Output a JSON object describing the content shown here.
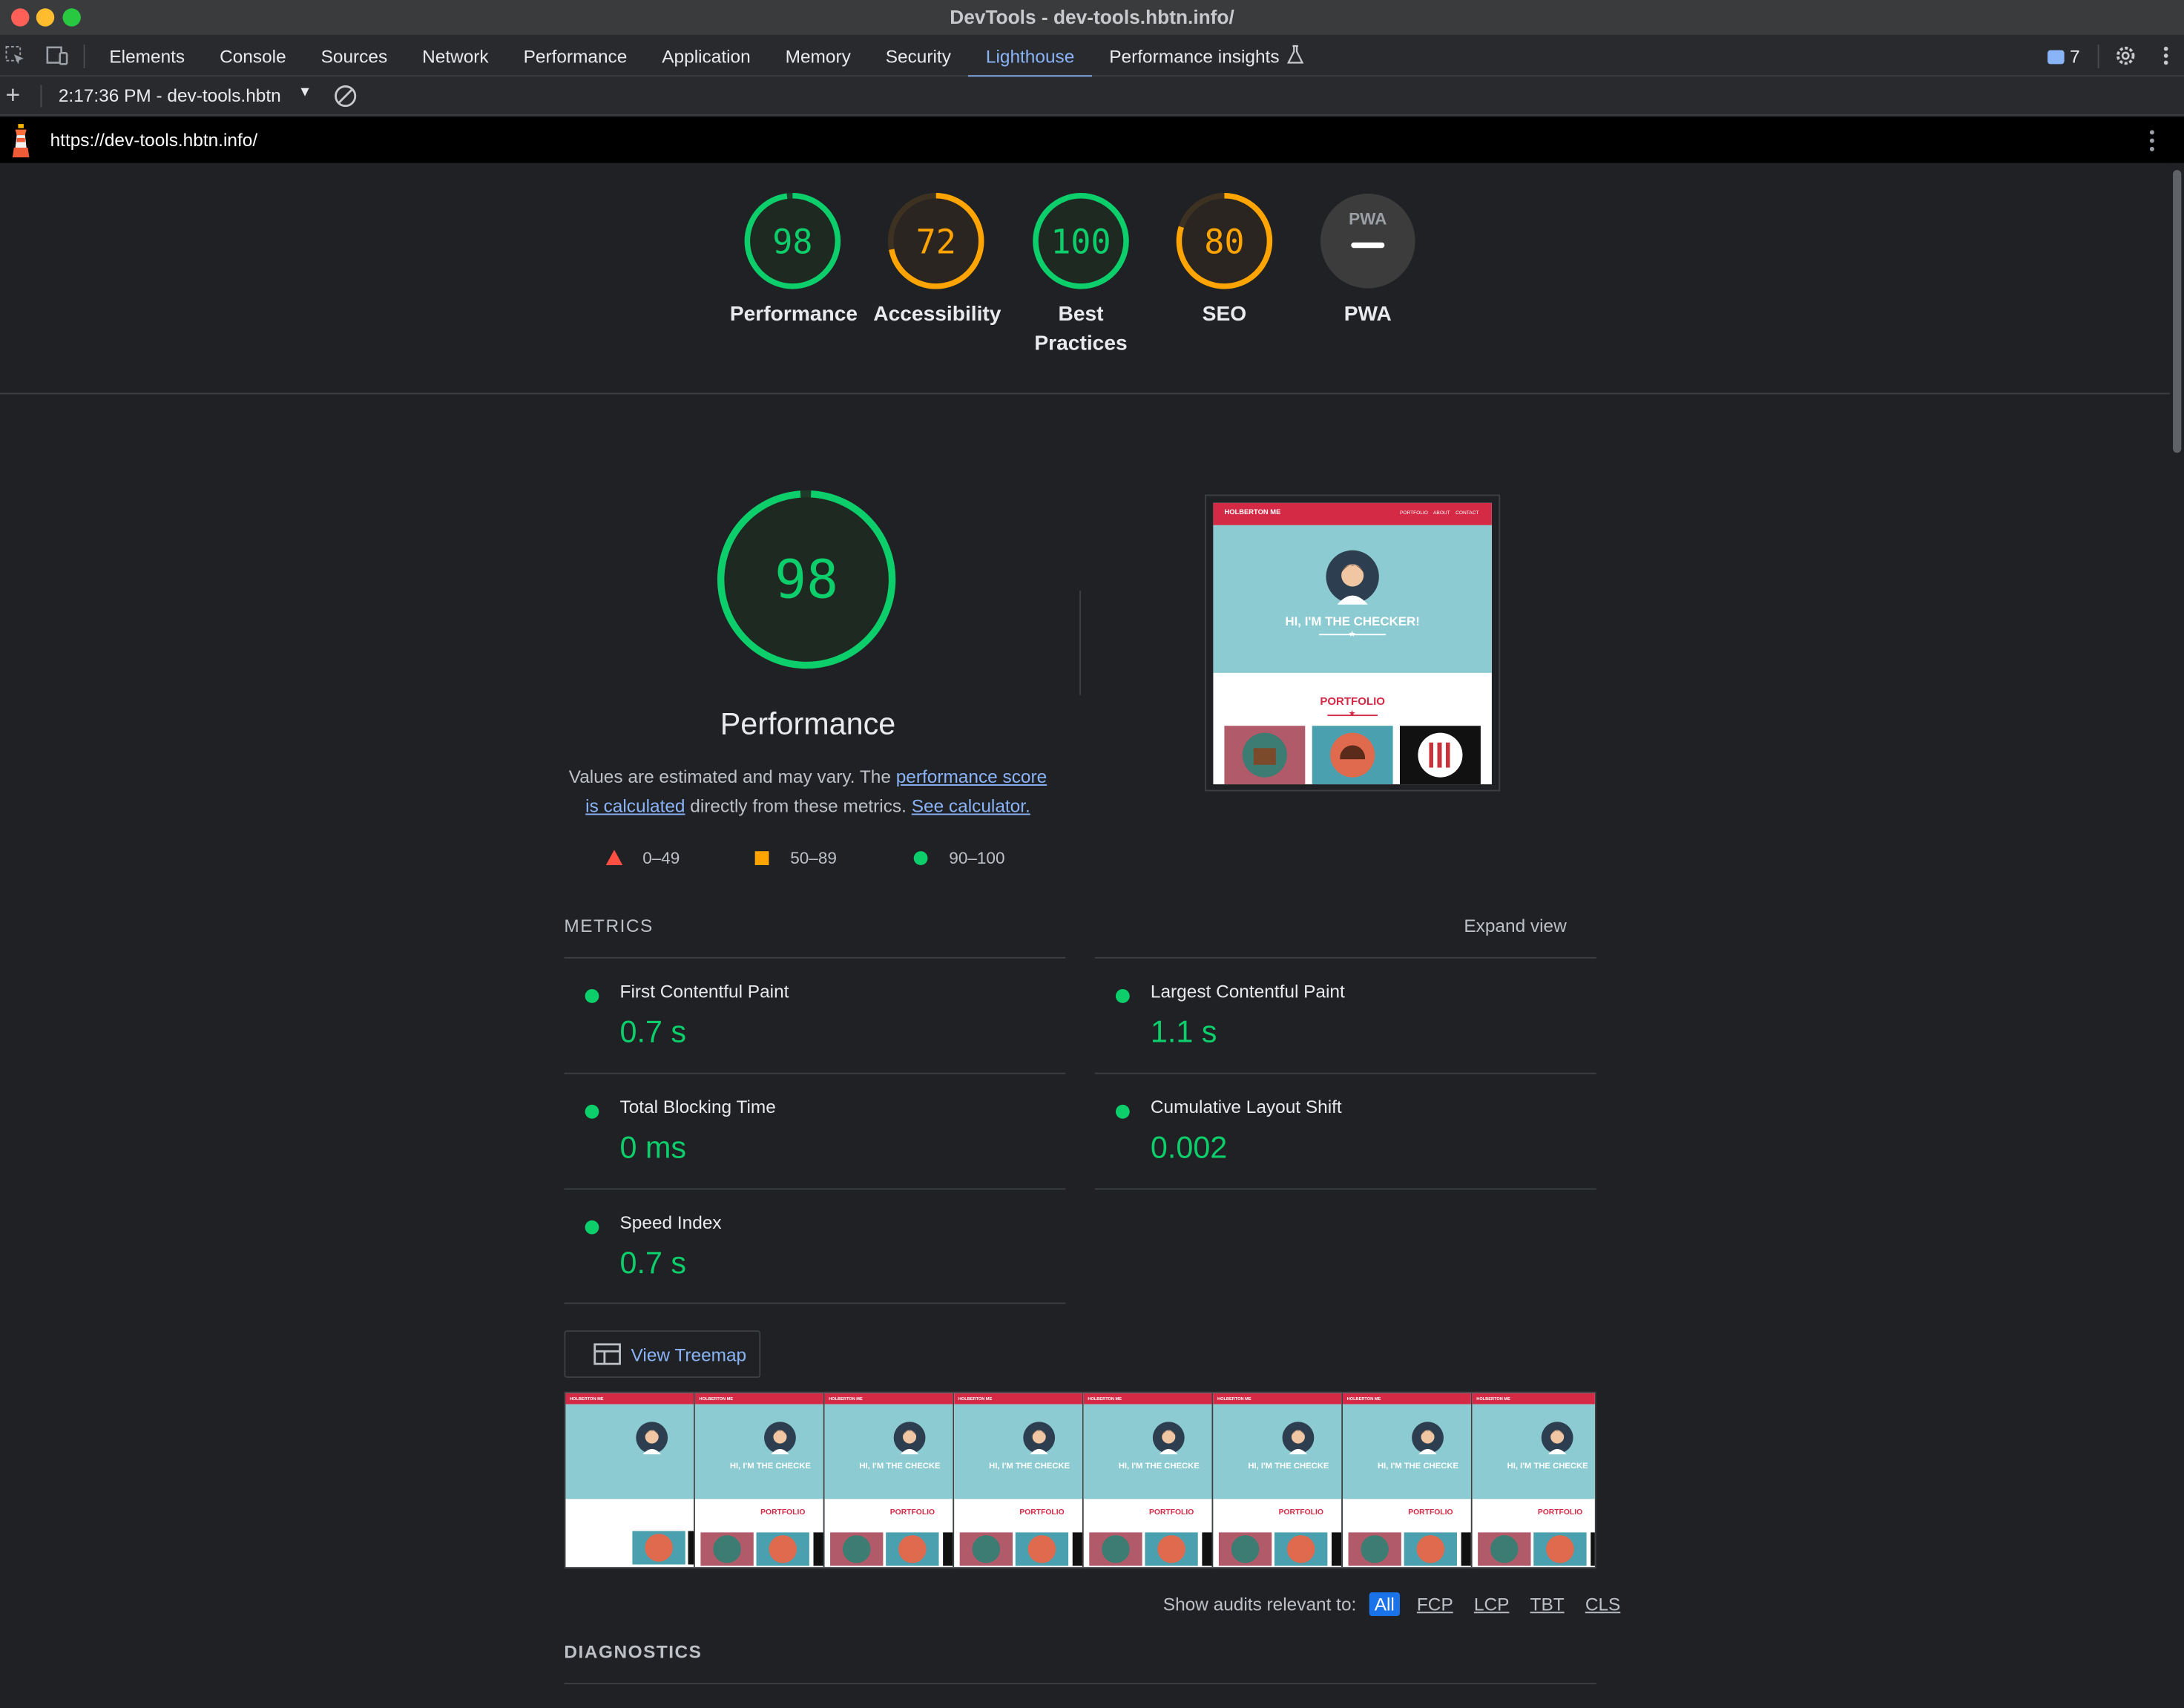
{
  "window": {
    "title": "DevTools - dev-tools.hbtn.info/"
  },
  "toolbar": {
    "tabs": [
      "Elements",
      "Console",
      "Sources",
      "Network",
      "Performance",
      "Application",
      "Memory",
      "Security",
      "Lighthouse",
      "Performance insights"
    ],
    "active_tab": "Lighthouse",
    "issues_count": "7"
  },
  "report_bar": {
    "report_select": "2:17:36 PM - dev-tools.hbtn"
  },
  "url_bar": {
    "url": "https://dev-tools.hbtn.info/"
  },
  "gauges": [
    {
      "score": "98",
      "label": "Performance",
      "fraction": 0.98,
      "color": "#0cce6b"
    },
    {
      "score": "72",
      "label": "Accessibility",
      "fraction": 0.72,
      "color": "#ffa400"
    },
    {
      "score": "100",
      "label": "Best Practices",
      "fraction": 1.0,
      "color": "#0cce6b"
    },
    {
      "score": "80",
      "label": "SEO",
      "fraction": 0.8,
      "color": "#ffa400"
    },
    {
      "score": "",
      "label": "PWA",
      "badge": "PWA"
    }
  ],
  "performance": {
    "score": "98",
    "fraction": 0.98,
    "title": "Performance",
    "desc_1": "Values are estimated and may vary. The ",
    "link_1": "performance score is calculated",
    "desc_2": " directly from these metrics. ",
    "link_2": "See calculator.",
    "legend": [
      "0–49",
      "50–89",
      "90–100"
    ]
  },
  "screenshot": {
    "brand": "HOLBERTON ME",
    "nav": [
      "PORTFOLIO",
      "ABOUT",
      "CONTACT"
    ],
    "hero": "HI, I'M THE CHECKER!",
    "section": "PORTFOLIO",
    "frame_hero": "HI, I'M THE CHECKE",
    "frame_section": "PORTFOLIO"
  },
  "metrics": {
    "heading": "METRICS",
    "expand": "Expand view",
    "items": [
      {
        "name": "First Contentful Paint",
        "value": "0.7 s"
      },
      {
        "name": "Largest Contentful Paint",
        "value": "1.1 s"
      },
      {
        "name": "Total Blocking Time",
        "value": "0 ms"
      },
      {
        "name": "Cumulative Layout Shift",
        "value": "0.002"
      },
      {
        "name": "Speed Index",
        "value": "0.7 s"
      }
    ]
  },
  "treemap_label": "View Treemap",
  "filter": {
    "label": "Show audits relevant to:",
    "chips": [
      "All",
      "FCP",
      "LCP",
      "TBT",
      "CLS"
    ],
    "active": "All"
  },
  "diagnostics": "DIAGNOSTICS",
  "colors": {
    "pass": "#0cce6b",
    "average": "#ffa400",
    "fail": "#ff4e42",
    "link": "#8ab4f8",
    "site_red": "#d42a46",
    "site_teal": "#8ccbd1"
  }
}
